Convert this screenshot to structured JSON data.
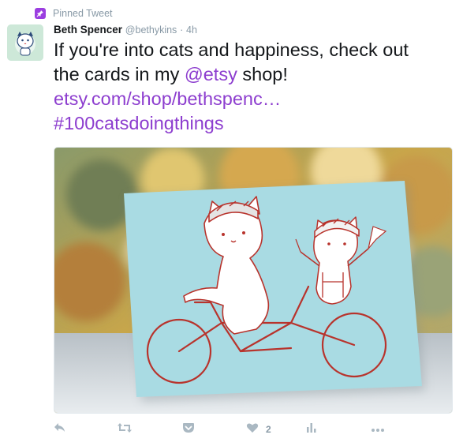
{
  "pinned": {
    "label": "Pinned Tweet",
    "icon": "pin-icon",
    "accent": "#9b3ee0"
  },
  "author": {
    "name": "Beth Spencer",
    "handle": "@bethykins",
    "separator": "·",
    "time": "4h"
  },
  "tweet": {
    "line1": "If you're into cats and happiness, check out",
    "line2_before": "the cards in my ",
    "mention": "@etsy",
    "line2_after": " shop!",
    "url": "etsy.com/shop/bethspenc…",
    "hashtag": "#100catsdoingthings",
    "link_color": "#8d3ecf"
  },
  "media": {
    "description_icon": "photo-card-cats-on-tandem-bicycle"
  },
  "actions": {
    "reply_icon": "reply-icon",
    "retweet_icon": "retweet-icon",
    "pocket_icon": "pocket-icon",
    "like_icon": "heart-icon",
    "like_count": "2",
    "analytics_icon": "analytics-icon",
    "more_icon": "more-icon"
  }
}
